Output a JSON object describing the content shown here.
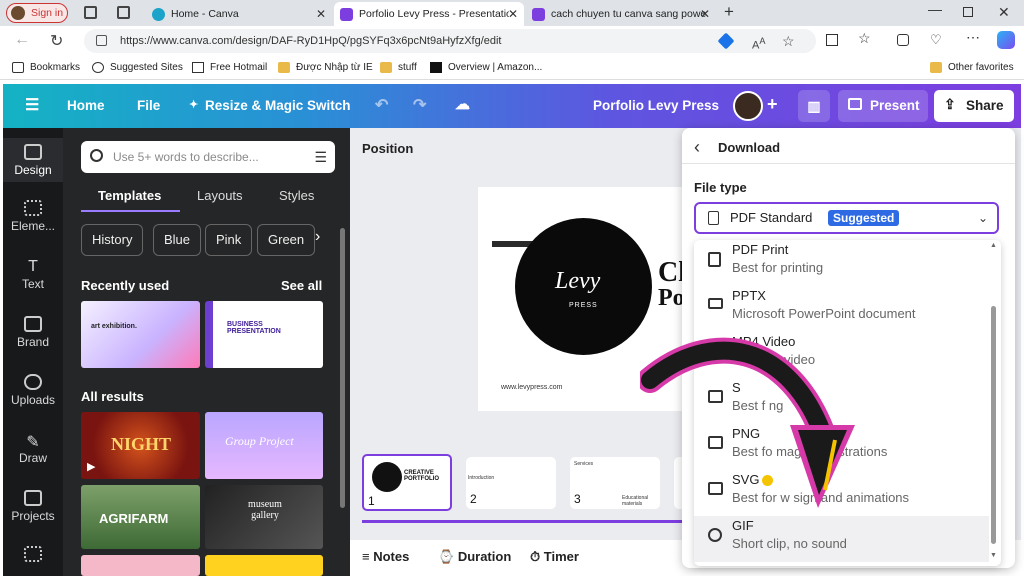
{
  "browser": {
    "signin": "Sign in",
    "tabs": [
      {
        "title": "Home - Canva"
      },
      {
        "title": "Porfolio Levy Press - Presentation"
      },
      {
        "title": "cach chuyen tu canva sang powe"
      }
    ],
    "url": "https://www.canva.com/design/DAF-RyD1HpQ/pgSYFq3x6pcNt9aHyfzXfg/edit",
    "bookmarks": [
      "Bookmarks",
      "Suggested Sites",
      "Free Hotmail",
      "Được Nhập từ IE",
      "stuff",
      "Overview | Amazon...",
      "Other favorites"
    ]
  },
  "topbar": {
    "home": "Home",
    "file": "File",
    "resize": "Resize & Magic Switch",
    "design_title": "Porfolio Levy Press",
    "present": "Present",
    "share": "Share"
  },
  "sidenav": [
    "Design",
    "Eleme...",
    "Text",
    "Brand",
    "Uploads",
    "Draw",
    "Projects"
  ],
  "panel": {
    "search_placeholder": "Use 5+ words to describe...",
    "tabs": [
      "Templates",
      "Layouts",
      "Styles"
    ],
    "chips": [
      "History",
      "Blue",
      "Pink",
      "Green"
    ],
    "recently_used": "Recently used",
    "see_all": "See all",
    "all_results": "All results",
    "thumb_texts": [
      "art exhibition.",
      "BUSINESS PRESENTATION",
      "NIGHT",
      "Group Project",
      "AGRIFARM",
      "museum gallery"
    ]
  },
  "canvas": {
    "position_label": "Position",
    "logo_text": "Levy",
    "logo_sub": "PRESS",
    "slide_title": "Cl",
    "slide_title2": "Po",
    "website": "www.levypress.com",
    "pages": [
      "1",
      "2",
      "3"
    ],
    "page1_text": "CREATIVE PORTFOLIO",
    "page2_text": "Introduction",
    "page3_text": "Services",
    "page3_sub": "Educational materials"
  },
  "bottombar": {
    "notes": "Notes",
    "duration": "Duration",
    "timer": "Timer"
  },
  "download": {
    "title": "Download",
    "file_type_label": "File type",
    "selected": "PDF Standard",
    "suggested": "Suggested",
    "options": [
      {
        "name": "PDF Print",
        "desc": "Best for printing"
      },
      {
        "name": "PPTX",
        "desc": "Microsoft PowerPoint document"
      },
      {
        "name": "MP4 Video",
        "desc": "h quality video"
      },
      {
        "name": "S",
        "desc": "Best f      ng"
      },
      {
        "name": "PNG",
        "desc": "Best fo        mages, illustrations"
      },
      {
        "name": "SVG",
        "desc": "Best for w    sign and animations"
      },
      {
        "name": "GIF",
        "desc": "Short clip, no sound"
      }
    ]
  },
  "colors": {
    "accent": "#7d3ee0",
    "arrow": "#1a1a1a",
    "arrow_outline": "#d63aa8",
    "arrow_highlight": "#f5c400"
  }
}
